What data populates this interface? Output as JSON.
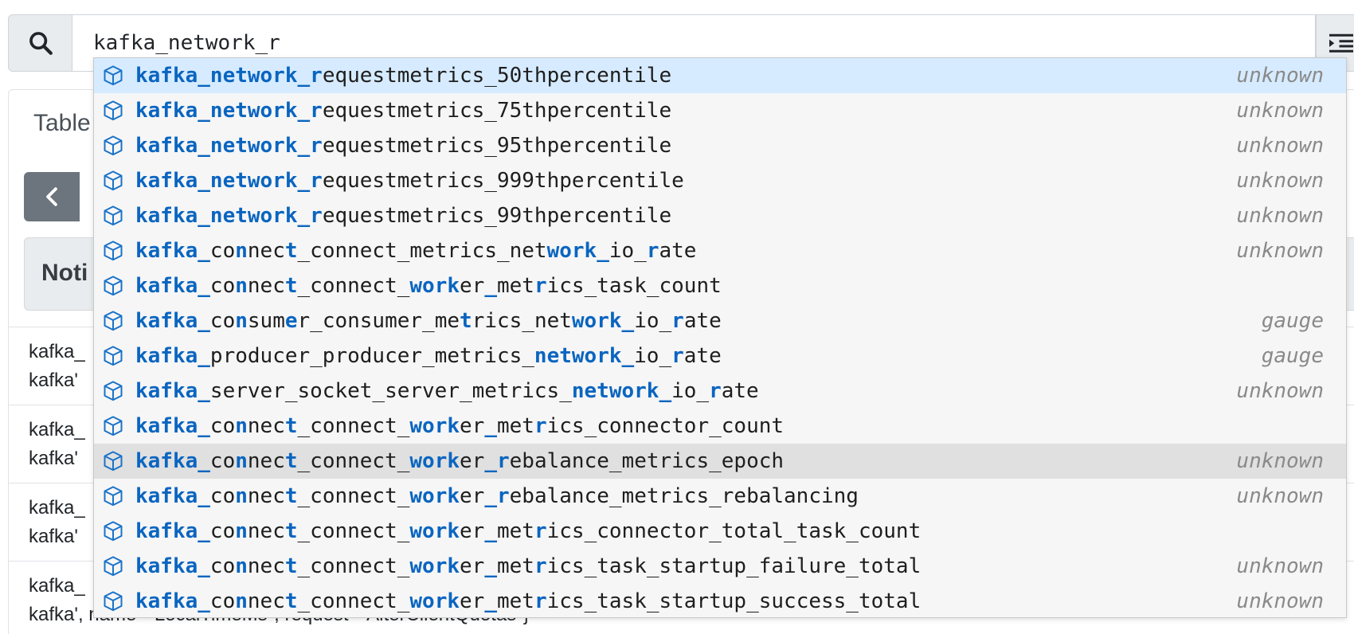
{
  "query": {
    "value": "kafka_network_r",
    "search_icon": "search-icon",
    "format_icon": "indent-icon"
  },
  "panel": {
    "tab_label": "Table",
    "alert_title": "Noti",
    "results": [
      {
        "line1": "kafka_",
        "line2": "kafka'",
        "suffix": ")"
      },
      {
        "line1": "kafka_",
        "line2": "kafka'",
        "suffix": ")"
      },
      {
        "line1": "kafka_",
        "line2": "kafka'",
        "suffix": ""
      },
      {
        "line1": "kafka_",
        "line2": "kafka', name=\"LocalTimeMs\", request=\"AlterClientQuotas\"}",
        "suffix": ")"
      }
    ]
  },
  "autocomplete": {
    "icon": "cube-icon",
    "selected_index": 0,
    "hovered_index": 11,
    "items": [
      {
        "segments": [
          {
            "t": "kafka_network_r",
            "m": true
          },
          {
            "t": "equestmetrics_50thpercentile",
            "m": false
          }
        ],
        "type": "unknown"
      },
      {
        "segments": [
          {
            "t": "kafka_network_r",
            "m": true
          },
          {
            "t": "equestmetrics_75thpercentile",
            "m": false
          }
        ],
        "type": "unknown"
      },
      {
        "segments": [
          {
            "t": "kafka_network_r",
            "m": true
          },
          {
            "t": "equestmetrics_95thpercentile",
            "m": false
          }
        ],
        "type": "unknown"
      },
      {
        "segments": [
          {
            "t": "kafka_network_r",
            "m": true
          },
          {
            "t": "equestmetrics_999thpercentile",
            "m": false
          }
        ],
        "type": "unknown"
      },
      {
        "segments": [
          {
            "t": "kafka_network_r",
            "m": true
          },
          {
            "t": "equestmetrics_99thpercentile",
            "m": false
          }
        ],
        "type": "unknown"
      },
      {
        "segments": [
          {
            "t": "kafka_",
            "m": true
          },
          {
            "t": "co",
            "m": false
          },
          {
            "t": "n",
            "m": true
          },
          {
            "t": "nec",
            "m": false
          },
          {
            "t": "t",
            "m": true
          },
          {
            "t": "_connect_metrics_net",
            "m": false
          },
          {
            "t": "work_",
            "m": true
          },
          {
            "t": "io_",
            "m": false
          },
          {
            "t": "r",
            "m": true
          },
          {
            "t": "ate",
            "m": false
          }
        ],
        "type": "unknown"
      },
      {
        "segments": [
          {
            "t": "kafka_",
            "m": true
          },
          {
            "t": "co",
            "m": false
          },
          {
            "t": "n",
            "m": true
          },
          {
            "t": "nec",
            "m": false
          },
          {
            "t": "t",
            "m": true
          },
          {
            "t": "_connect_",
            "m": false
          },
          {
            "t": "work",
            "m": true
          },
          {
            "t": "er",
            "m": false
          },
          {
            "t": "_",
            "m": true
          },
          {
            "t": "met",
            "m": false
          },
          {
            "t": "r",
            "m": true
          },
          {
            "t": "ics_task_count",
            "m": false
          }
        ],
        "type": ""
      },
      {
        "segments": [
          {
            "t": "kafka_",
            "m": true
          },
          {
            "t": "co",
            "m": false
          },
          {
            "t": "n",
            "m": true
          },
          {
            "t": "sum",
            "m": false
          },
          {
            "t": "e",
            "m": true
          },
          {
            "t": "r_consumer_me",
            "m": false
          },
          {
            "t": "t",
            "m": true
          },
          {
            "t": "rics_net",
            "m": false
          },
          {
            "t": "work_",
            "m": true
          },
          {
            "t": "io_",
            "m": false
          },
          {
            "t": "r",
            "m": true
          },
          {
            "t": "ate",
            "m": false
          }
        ],
        "type": "gauge"
      },
      {
        "segments": [
          {
            "t": "kafka_",
            "m": true
          },
          {
            "t": "producer_producer_metrics_",
            "m": false
          },
          {
            "t": "network_",
            "m": true
          },
          {
            "t": "io_",
            "m": false
          },
          {
            "t": "r",
            "m": true
          },
          {
            "t": "ate",
            "m": false
          }
        ],
        "type": "gauge"
      },
      {
        "segments": [
          {
            "t": "kafka_",
            "m": true
          },
          {
            "t": "server_socket_server_metrics_",
            "m": false
          },
          {
            "t": "network_",
            "m": true
          },
          {
            "t": "io_",
            "m": false
          },
          {
            "t": "r",
            "m": true
          },
          {
            "t": "ate",
            "m": false
          }
        ],
        "type": "unknown"
      },
      {
        "segments": [
          {
            "t": "kafka_",
            "m": true
          },
          {
            "t": "co",
            "m": false
          },
          {
            "t": "n",
            "m": true
          },
          {
            "t": "nec",
            "m": false
          },
          {
            "t": "t",
            "m": true
          },
          {
            "t": "_connect_",
            "m": false
          },
          {
            "t": "work",
            "m": true
          },
          {
            "t": "er",
            "m": false
          },
          {
            "t": "_",
            "m": true
          },
          {
            "t": "met",
            "m": false
          },
          {
            "t": "r",
            "m": true
          },
          {
            "t": "ics_connector_count",
            "m": false
          }
        ],
        "type": ""
      },
      {
        "segments": [
          {
            "t": "kafka_",
            "m": true
          },
          {
            "t": "co",
            "m": false
          },
          {
            "t": "n",
            "m": true
          },
          {
            "t": "nec",
            "m": false
          },
          {
            "t": "t",
            "m": true
          },
          {
            "t": "_connect_",
            "m": false
          },
          {
            "t": "work",
            "m": true
          },
          {
            "t": "er",
            "m": false
          },
          {
            "t": "_r",
            "m": true
          },
          {
            "t": "ebalance_metrics_epoch",
            "m": false
          }
        ],
        "type": "unknown"
      },
      {
        "segments": [
          {
            "t": "kafka_",
            "m": true
          },
          {
            "t": "co",
            "m": false
          },
          {
            "t": "n",
            "m": true
          },
          {
            "t": "nec",
            "m": false
          },
          {
            "t": "t",
            "m": true
          },
          {
            "t": "_connect_",
            "m": false
          },
          {
            "t": "work",
            "m": true
          },
          {
            "t": "er",
            "m": false
          },
          {
            "t": "_r",
            "m": true
          },
          {
            "t": "ebalance_metrics_rebalancing",
            "m": false
          }
        ],
        "type": "unknown"
      },
      {
        "segments": [
          {
            "t": "kafka_",
            "m": true
          },
          {
            "t": "co",
            "m": false
          },
          {
            "t": "n",
            "m": true
          },
          {
            "t": "nec",
            "m": false
          },
          {
            "t": "t",
            "m": true
          },
          {
            "t": "_connect_",
            "m": false
          },
          {
            "t": "work",
            "m": true
          },
          {
            "t": "er",
            "m": false
          },
          {
            "t": "_",
            "m": true
          },
          {
            "t": "met",
            "m": false
          },
          {
            "t": "r",
            "m": true
          },
          {
            "t": "ics_connector_total_task_count",
            "m": false
          }
        ],
        "type": ""
      },
      {
        "segments": [
          {
            "t": "kafka_",
            "m": true
          },
          {
            "t": "co",
            "m": false
          },
          {
            "t": "n",
            "m": true
          },
          {
            "t": "nec",
            "m": false
          },
          {
            "t": "t",
            "m": true
          },
          {
            "t": "_connect_",
            "m": false
          },
          {
            "t": "work",
            "m": true
          },
          {
            "t": "er",
            "m": false
          },
          {
            "t": "_",
            "m": true
          },
          {
            "t": "met",
            "m": false
          },
          {
            "t": "r",
            "m": true
          },
          {
            "t": "ics_task_startup_failure_total",
            "m": false
          }
        ],
        "type": "unknown"
      },
      {
        "segments": [
          {
            "t": "kafka_",
            "m": true
          },
          {
            "t": "co",
            "m": false
          },
          {
            "t": "n",
            "m": true
          },
          {
            "t": "nec",
            "m": false
          },
          {
            "t": "t",
            "m": true
          },
          {
            "t": "_connect_",
            "m": false
          },
          {
            "t": "work",
            "m": true
          },
          {
            "t": "er",
            "m": false
          },
          {
            "t": "_",
            "m": true
          },
          {
            "t": "met",
            "m": false
          },
          {
            "t": "r",
            "m": true
          },
          {
            "t": "ics_task_startup_success_total",
            "m": false
          }
        ],
        "type": "unknown"
      }
    ]
  }
}
